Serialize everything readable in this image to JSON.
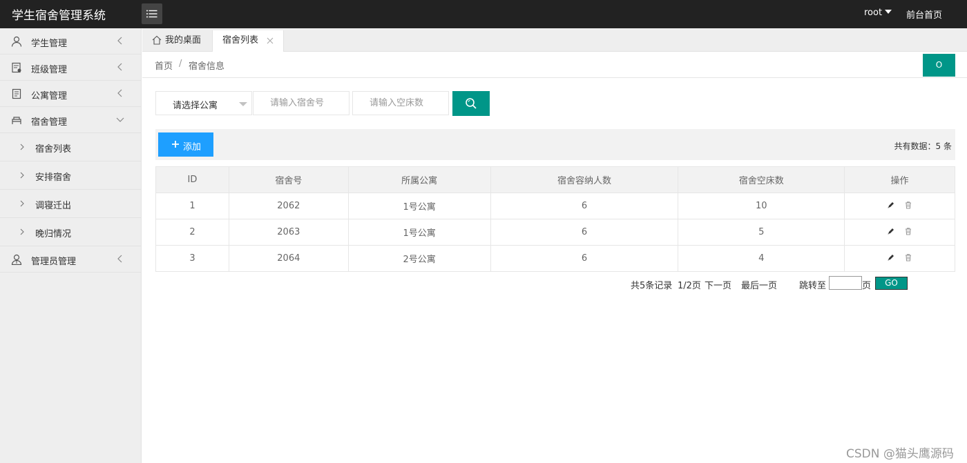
{
  "app": {
    "title": "学生宿舍管理系统"
  },
  "header": {
    "user": "root",
    "home_link": "前台首页"
  },
  "sidebar": {
    "items": [
      {
        "label": "学生管理",
        "icon": "user-icon",
        "expanded": false
      },
      {
        "label": "班级管理",
        "icon": "class-icon",
        "expanded": false
      },
      {
        "label": "公寓管理",
        "icon": "document-icon",
        "expanded": false
      },
      {
        "label": "宿舍管理",
        "icon": "dorm-icon",
        "expanded": true
      },
      {
        "label": "管理员管理",
        "icon": "admin-icon",
        "expanded": false
      }
    ],
    "sub_items": [
      {
        "label": "宿舍列表"
      },
      {
        "label": "安排宿舍"
      },
      {
        "label": "调寝迁出"
      },
      {
        "label": "晚归情况"
      }
    ]
  },
  "tabs": [
    {
      "label": "我的桌面",
      "icon": "home-icon",
      "active": false
    },
    {
      "label": "宿舍列表",
      "active": true,
      "closable": true
    }
  ],
  "breadcrumb": {
    "home": "首页",
    "separator": "/",
    "current": "宿舍信息"
  },
  "refresh_label": "O",
  "search": {
    "apartment_select": "请选择公寓",
    "room_placeholder": "请输入宿舍号",
    "empty_bed_placeholder": "请输入空床数",
    "button_icon": "search-icon"
  },
  "toolbar": {
    "add_label": "添加",
    "total_label": "共有数据：5 条"
  },
  "table": {
    "headers": [
      "ID",
      "宿舍号",
      "所属公寓",
      "宿舍容纳人数",
      "宿舍空床数",
      "操作"
    ],
    "rows": [
      {
        "id": "1",
        "room": "2062",
        "apartment": "1号公寓",
        "capacity": "6",
        "empty": "10"
      },
      {
        "id": "2",
        "room": "2063",
        "apartment": "1号公寓",
        "capacity": "6",
        "empty": "5"
      },
      {
        "id": "3",
        "room": "2064",
        "apartment": "2号公寓",
        "capacity": "6",
        "empty": "4"
      }
    ]
  },
  "pager": {
    "records": "共5条记录",
    "pages": "1/2页",
    "next": "下一页",
    "last": "最后一页",
    "goto_prefix": "跳转至",
    "goto_suffix": "页",
    "go_label": "GO"
  },
  "watermark": "CSDN @猫头鹰源码",
  "colors": {
    "header_bg": "#222222",
    "primary": "#009688",
    "add_button": "#1e9fff",
    "sidebar_bg": "#eeeeee"
  }
}
